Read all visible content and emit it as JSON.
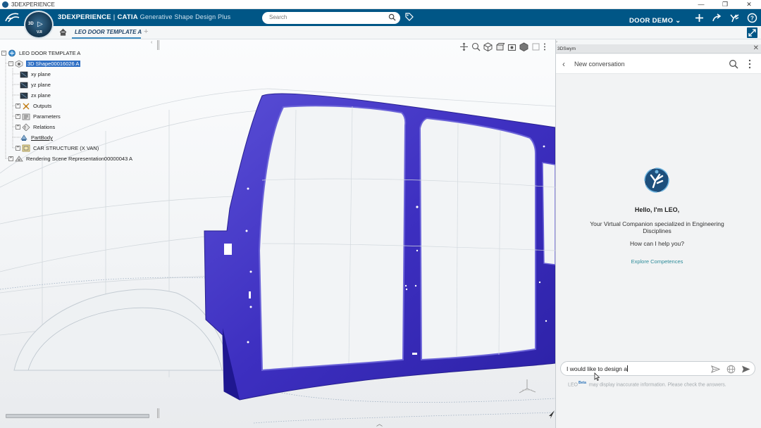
{
  "os": {
    "title": "3DEXPERIENCE",
    "controls": [
      "—",
      "❐",
      "✕"
    ]
  },
  "header": {
    "brand": "3DEXPERIENCE",
    "app": "CATIA",
    "app_sub": "Generative Shape Design Plus",
    "compass_3d": "3D",
    "compass_vr": "V.R",
    "search_placeholder": "Search",
    "tenant": "DOOR DEMO",
    "tenant_chevron": "⌄"
  },
  "tabs": {
    "active_label": "LEO DOOR TEMPLATE A",
    "add": "+"
  },
  "tree": {
    "root": "LEO DOOR TEMPLATE A",
    "shape": "3D Shape00016026 A",
    "items": [
      {
        "label": "xy plane",
        "icon": "plane-icon",
        "expander": ""
      },
      {
        "label": "yz plane",
        "icon": "plane-icon",
        "expander": ""
      },
      {
        "label": "zx plane",
        "icon": "plane-icon",
        "expander": ""
      },
      {
        "label": "Outputs",
        "icon": "outputs-icon",
        "expander": "+"
      },
      {
        "label": "Parameters",
        "icon": "parameters-icon",
        "expander": "+"
      },
      {
        "label": "Relations",
        "icon": "relations-icon",
        "expander": "+"
      },
      {
        "label": "PartBody",
        "icon": "partbody-icon",
        "expander": ""
      },
      {
        "label": "CAR STRUCTURE (X VAN)",
        "icon": "geometrical-set-icon",
        "expander": "+"
      }
    ],
    "rendering": "Rendering Scene Representation00000043 A",
    "collapse": "‹"
  },
  "viewport": {
    "chevron": "︿"
  },
  "panel": {
    "tab_label": "3DSwym",
    "close": "✕",
    "back": "‹",
    "title": "New conversation",
    "greeting": "Hello, I'm LEO,",
    "intro": "Your Virtual Companion specialized in Engineering Disciplines",
    "help": "How can I help you?",
    "explore": "Explore Competences",
    "input_value": "I would like to design a",
    "disclaimer_name": "LEO",
    "disclaimer_beta": "Beta",
    "disclaimer_text": "may display inaccurate information. Please check the answers."
  },
  "colors": {
    "header_bg": "#005686",
    "part_blue": "#3d2fc0",
    "selection": "#2f6fc4",
    "link_teal": "#2e8c9a"
  }
}
